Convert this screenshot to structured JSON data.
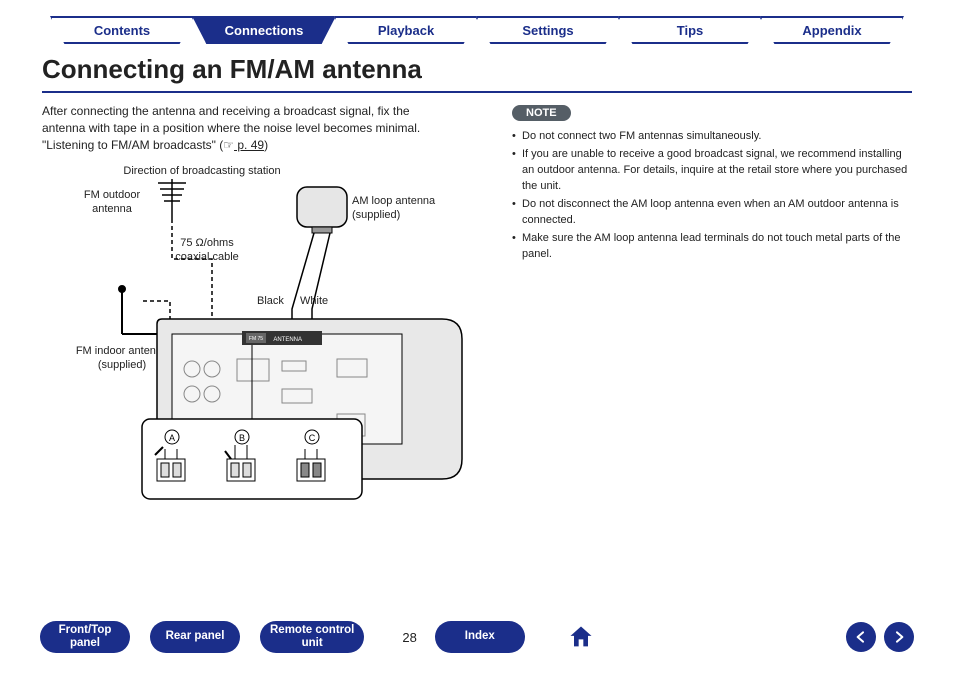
{
  "tabs": [
    {
      "label": "Contents",
      "active": false
    },
    {
      "label": "Connections",
      "active": true
    },
    {
      "label": "Playback",
      "active": false
    },
    {
      "label": "Settings",
      "active": false
    },
    {
      "label": "Tips",
      "active": false
    },
    {
      "label": "Appendix",
      "active": false
    }
  ],
  "title": "Connecting an FM/AM antenna",
  "intro_line1": "After connecting the antenna and receiving a broadcast signal, fix the",
  "intro_line2": "antenna with tape in a position where the noise level becomes minimal.",
  "intro_ref_prefix": "\"Listening to FM/AM broadcasts\" (",
  "intro_ref_icon": "☞",
  "intro_ref_link": " p. 49",
  "intro_ref_suffix": ")",
  "diagram": {
    "direction_label": "Direction of broadcasting station",
    "fm_outdoor": "FM outdoor\nantenna",
    "coax": "75 Ω/ohms\ncoaxial cable",
    "am_loop": "AM loop antenna\n(supplied)",
    "black": "Black",
    "white": "White",
    "fm_indoor": "FM indoor antenna\n(supplied)",
    "panel_text": "ANTENNA",
    "fm_port": "FM 75",
    "step_a": "A",
    "step_b": "B",
    "step_c": "C"
  },
  "note_label": "NOTE",
  "notes": [
    "Do not connect two FM antennas simultaneously.",
    "If you are unable to receive a good broadcast signal, we recommend installing an outdoor antenna. For details, inquire at the retail store where you purchased the unit.",
    "Do not disconnect the AM loop antenna even when an AM outdoor antenna is connected.",
    "Make sure the AM loop antenna lead terminals do not touch metal parts of the panel."
  ],
  "bottom": {
    "front_top_l1": "Front/Top",
    "front_top_l2": "panel",
    "rear_panel": "Rear panel",
    "remote_l1": "Remote control",
    "remote_l2": "unit",
    "page_number": "28",
    "index": "Index"
  }
}
